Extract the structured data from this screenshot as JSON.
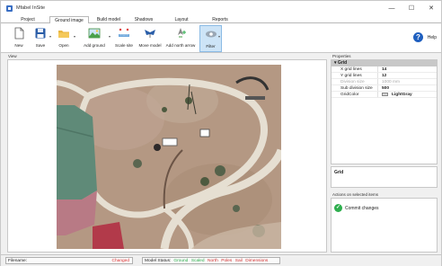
{
  "window": {
    "title": "Mfabel InSite",
    "minimize": "—",
    "maximize": "☐",
    "close": "✕"
  },
  "tabs": [
    {
      "label": "Project",
      "active": false
    },
    {
      "label": "Ground image",
      "active": true
    },
    {
      "label": "Build model",
      "active": false
    },
    {
      "label": "Shadows",
      "active": false
    },
    {
      "label": "Layout",
      "active": false
    },
    {
      "label": "Reports",
      "active": false
    }
  ],
  "toolbar": {
    "new": "New",
    "save": "Save",
    "open": "Open",
    "add_ground": "Add ground",
    "scale_site": "Scale site",
    "move_model": "Move model",
    "add_north_arrow": "Add north arrow",
    "filter": "Filter",
    "help": "Help",
    "help_icon": "?"
  },
  "view": {
    "label": "View"
  },
  "properties": {
    "label": "Properties",
    "category": "Grid",
    "rows": [
      {
        "name": "X grid lines",
        "value": "14",
        "disabled": false
      },
      {
        "name": "Y grid lines",
        "value": "12",
        "disabled": false
      },
      {
        "name": "Division size",
        "value": "1000 mm",
        "disabled": true
      },
      {
        "name": "Sub division size",
        "value": "500",
        "disabled": false
      },
      {
        "name": "GridColor",
        "value": "LightGray",
        "disabled": false
      }
    ],
    "description_title": "Grid"
  },
  "actions": {
    "label": "Actions on selected items",
    "commit": "Commit changes"
  },
  "status": {
    "filename_label": "Filename:",
    "filename_value": "Changed",
    "model_status_label": "Model Status:",
    "items": [
      "Ground",
      "Scaled",
      "North",
      "Poles",
      "Sail",
      "Dimensions"
    ]
  },
  "colors": {
    "accent": "#1f5fbf",
    "status_ok": "#2eae4e",
    "status_warn": "#d33333",
    "map_ground": "#b69a86",
    "map_path": "#e8e2d6",
    "grid_color": "#d3d3d3"
  },
  "icons": {
    "new": "new-document-icon",
    "save": "save-disk-icon",
    "open": "folder-icon",
    "add_ground": "landscape-image-icon",
    "scale_site": "scale-ruler-icon",
    "move_model": "move-model-icon",
    "add_north_arrow": "north-arrow-icon",
    "filter": "filter-eye-icon",
    "help": "help-icon",
    "commit": "checkmark-icon"
  }
}
